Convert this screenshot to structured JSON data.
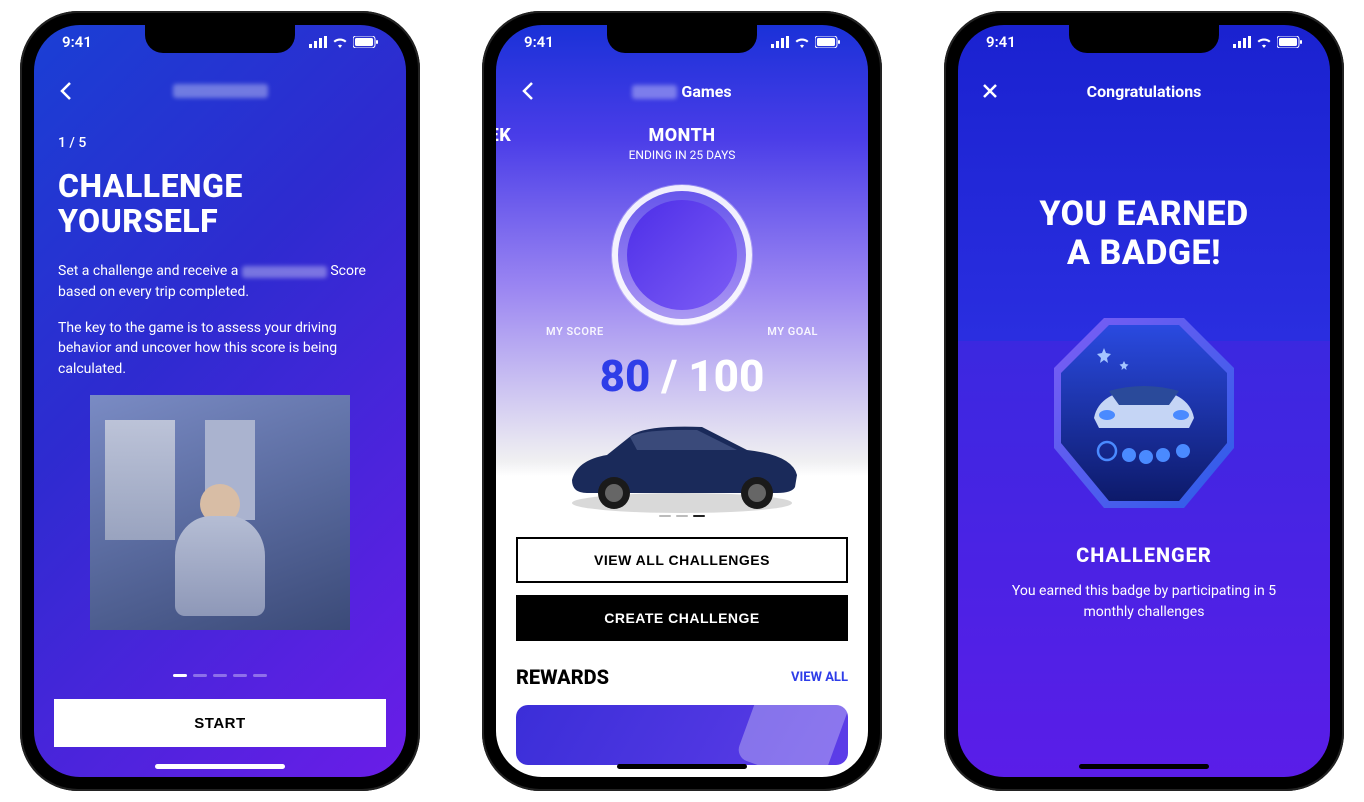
{
  "status": {
    "time": "9:41"
  },
  "screen1": {
    "step": "1 / 5",
    "title_line1": "CHALLENGE",
    "title_line2": "YOURSELF",
    "p1_pre": "Set a challenge and receive a ",
    "p1_post": " Score based on every trip completed.",
    "p2": "The key to the game is to assess your driving behavior and uncover how this score is being calculated.",
    "dots_total": 5,
    "dots_active": 0,
    "cta": "START"
  },
  "screen2": {
    "nav_title_suffix": "Games",
    "tab_left": "EEK",
    "tab_center": "MONTH",
    "tab_sub": "ENDING IN 25 DAYS",
    "label_left": "MY SCORE",
    "label_right": "MY GOAL",
    "score": "80",
    "slash": " / ",
    "goal": "100",
    "dots_total": 3,
    "dots_active": 2,
    "btn1": "VIEW ALL CHALLENGES",
    "btn2": "CREATE CHALLENGE",
    "rewards_title": "REWARDS",
    "rewards_link": "VIEW ALL"
  },
  "screen3": {
    "nav_title": "Congratulations",
    "title_line1": "YOU EARNED",
    "title_line2": "A BADGE!",
    "badge_name": "CHALLENGER",
    "badge_desc": "You earned this badge by participating in 5 monthly challenges"
  }
}
